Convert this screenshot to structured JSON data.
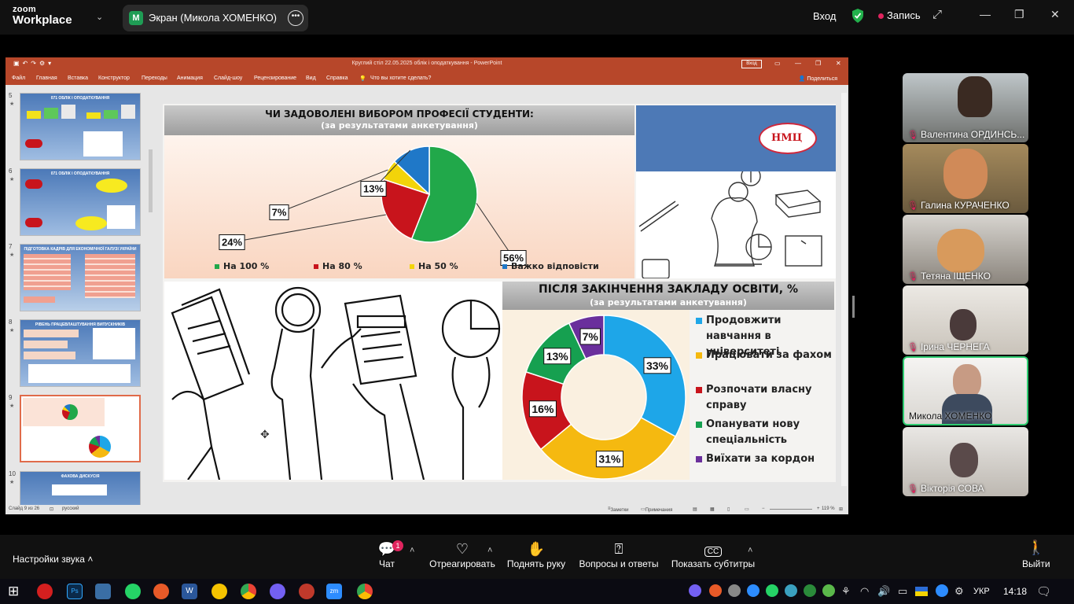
{
  "zoom": {
    "logo_line1": "zoom",
    "logo_line2": "Workplace",
    "share_initial": "M",
    "share_title": "Экран (Микола ХОМЕНКО)",
    "login": "Вход",
    "record": "Запись",
    "audio_settings": "Настройки звука",
    "tools": [
      {
        "label": "Чат",
        "icon": "chat-icon"
      },
      {
        "label": "Отреагировать",
        "icon": "heart-icon"
      },
      {
        "label": "Поднять руку",
        "icon": "hand-icon"
      },
      {
        "label": "Вопросы и ответы",
        "icon": "question-icon"
      },
      {
        "label": "Показать субтитры",
        "icon": "cc-icon"
      }
    ],
    "chat_badge": "1",
    "exit": "Выйти"
  },
  "ppt": {
    "title": "Круглий стіл 22.05.2025 облік і оподаткування  -  PowerPoint",
    "login": "Вход",
    "menu": [
      "Файл",
      "Главная",
      "Вставка",
      "Конструктор",
      "Переходы",
      "Анимация",
      "Слайд-шоу",
      "Рецензирование",
      "Вид",
      "Справка",
      "Что вы хотите сделать?"
    ],
    "share": "Поделиться",
    "status": {
      "slide": "Слайд 9 из 26",
      "lang": "русский",
      "notes": "Заметки",
      "comments": "Примечания",
      "zoom": "119 %"
    },
    "thumbs": [
      {
        "num": "5",
        "title": "071 ОБЛІК І ОПОДАТКУВАННЯ"
      },
      {
        "num": "6",
        "title": "071 ОБЛІК І ОПОДАТКУВАННЯ"
      },
      {
        "num": "7",
        "title": "ПІДГОТОВКА КАДРІВ ДЛЯ ЕКОНОМІЧНОЇ ГАЛУЗІ УКРАЇНИ"
      },
      {
        "num": "8",
        "title": "РІВЕНЬ ПРАЦЕВЛАШТУВАННЯ ВИПУСКНИКІВ"
      },
      {
        "num": "9",
        "title": ""
      },
      {
        "num": "10",
        "title": "ФАХОВА ДИСКУСІЯ"
      }
    ]
  },
  "slide": {
    "top_title": "ЧИ ЗАДОВОЛЕНІ ВИБОРОМ ПРОФЕСІЇ СТУДЕНТИ:",
    "top_subtitle": "(за результатами анкетування)",
    "bottom_title": "ПІСЛЯ ЗАКІНЧЕННЯ ЗАКЛАДУ ОСВІТИ, %",
    "bottom_subtitle": "(за результатами анкетування)",
    "logo_text": "НМЦ"
  },
  "chart_data": [
    {
      "type": "pie",
      "title": "ЧИ ЗАДОВОЛЕНІ ВИБОРОМ ПРОФЕСІЇ СТУДЕНТИ:",
      "categories": [
        "На 100 %",
        "На 80 %",
        "На 50 %",
        "Важко відповісти"
      ],
      "values": [
        56,
        24,
        7,
        13
      ],
      "labels": [
        "56%",
        "24%",
        "7%",
        "13%"
      ],
      "colors": [
        "#21a84a",
        "#c8141c",
        "#f2d40a",
        "#1f78c8"
      ],
      "legend": "bottom"
    },
    {
      "type": "pie",
      "title": "ПІСЛЯ ЗАКІНЧЕННЯ ЗАКЛАДУ ОСВІТИ, %",
      "categories": [
        "Продовжити навчання в університеті",
        "Працювати за фахом",
        "Розпочати власну справу",
        "Опанувати нову спеціальність",
        "Виїхати за кордон"
      ],
      "values": [
        33,
        31,
        16,
        13,
        7
      ],
      "labels": [
        "33%",
        "31%",
        "16%",
        "13%",
        "7%"
      ],
      "colors": [
        "#1ea6e8",
        "#f5b910",
        "#c8141c",
        "#16a050",
        "#6a2f9c"
      ],
      "legend": "right"
    }
  ],
  "participants": [
    {
      "name": "Валентина ОРДИНСЬ..."
    },
    {
      "name": "Галина КУРАЧЕНКО"
    },
    {
      "name": "Тетяна ІЩЕНКО"
    },
    {
      "name": "Ірина ЧЕРНЕГА"
    },
    {
      "name": "Микола ХОМЕНКО"
    },
    {
      "name": "Вікторія СОВА"
    }
  ],
  "taskbar": {
    "lang": "УКР",
    "time": "14:18"
  }
}
